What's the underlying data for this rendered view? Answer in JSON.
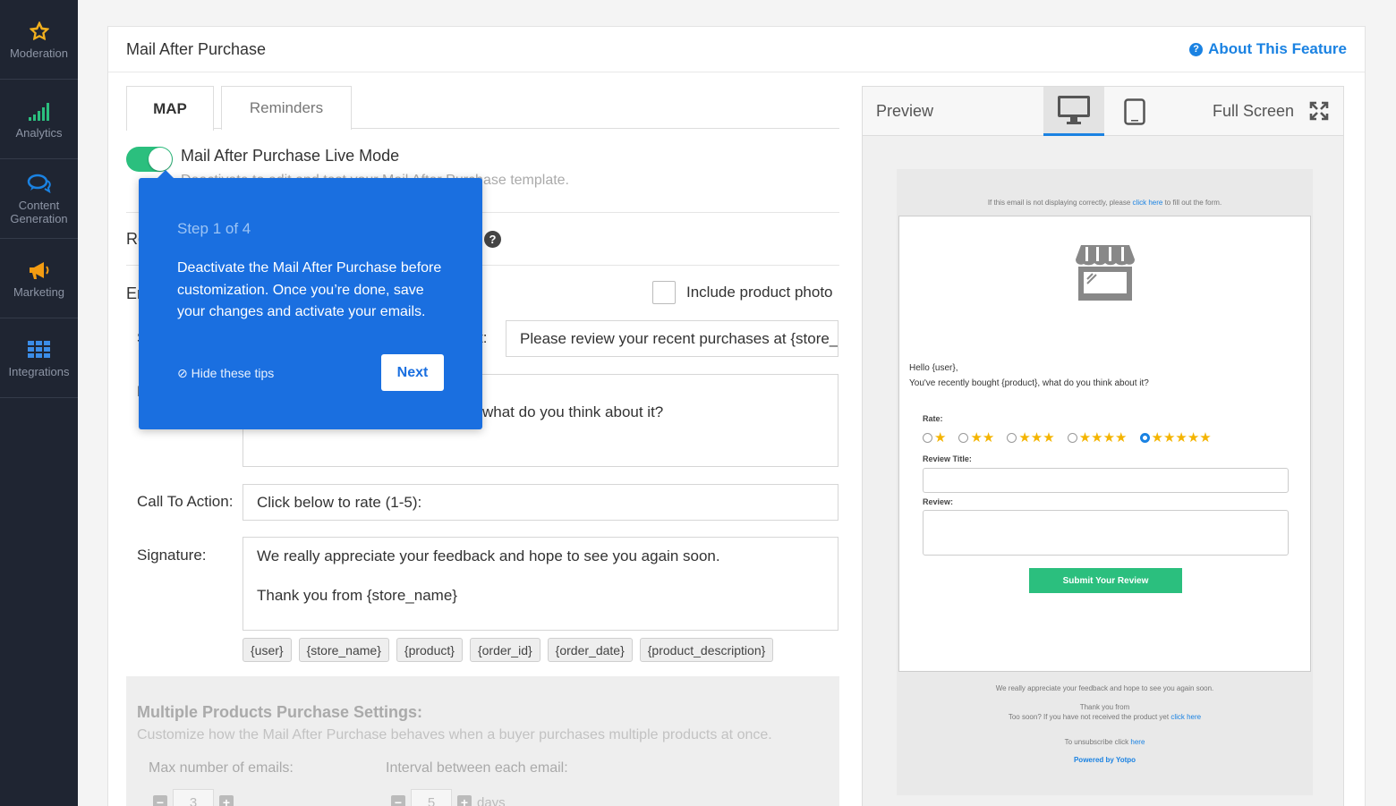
{
  "sidebar": {
    "items": [
      {
        "label": "Moderation",
        "icon": "star-icon"
      },
      {
        "label": "Analytics",
        "icon": "signal-bars-icon"
      },
      {
        "label": "Content Generation",
        "icon": "chat-bubbles-icon"
      },
      {
        "label": "Marketing",
        "icon": "megaphone-icon"
      },
      {
        "label": "Integrations",
        "icon": "grid-icon"
      }
    ]
  },
  "header": {
    "title": "Mail After Purchase",
    "about_link": "About This Feature"
  },
  "tabs": [
    {
      "label": "MAP",
      "active": true
    },
    {
      "label": "Reminders",
      "active": false
    }
  ],
  "live_mode": {
    "title": "Mail After Purchase Live Mode",
    "description": "Deactivate to edit and test your Mail After Purchase template.",
    "enabled": true
  },
  "sections": {
    "row2_label": "Re",
    "row3_label": "Er",
    "subject_label_partial": "S",
    "subject_colon": "t:",
    "body_label_partial": "B",
    "include_photo_label": "Include product photo",
    "include_photo_checked": false
  },
  "fields": {
    "subject_value": "Please review your recent purchases at {store_",
    "body_value": "what do you think about it?",
    "cta_label": "Call To Action:",
    "cta_value": "Click below to rate (1-5):",
    "signature_label": "Signature:",
    "signature_line1": "We really appreciate your feedback and hope to see you again soon.",
    "signature_line2": "Thank you from {store_name}"
  },
  "variable_tags": [
    "{user}",
    "{store_name}",
    "{product}",
    "{order_id}",
    "{order_date}",
    "{product_description}"
  ],
  "multi_products": {
    "title": "Multiple Products Purchase Settings:",
    "description": "Customize how the Mail After Purchase behaves when a buyer purchases multiple products at once.",
    "max_label": "Max number of emails:",
    "max_value": "3",
    "interval_label": "Interval between each email:",
    "interval_value": "5",
    "interval_unit": "days"
  },
  "preview": {
    "label": "Preview",
    "fullscreen_label": "Full Screen",
    "devices": [
      "desktop-icon",
      "tablet-icon"
    ],
    "active_device": "desktop-icon",
    "email": {
      "top_text": "If this email is not displaying correctly, please",
      "top_link": "click here",
      "top_text_end": "to fill out the form.",
      "greeting": "Hello {user},",
      "question": "You've recently bought {product}, what do you think about it?",
      "rate_label": "Rate:",
      "rating_options": [
        "★",
        "★★",
        "★★★",
        "★★★★",
        "★★★★★"
      ],
      "selected_rating": 5,
      "review_title_label": "Review Title:",
      "review_label": "Review:",
      "submit_label": "Submit Your Review",
      "footer_line1": "We really appreciate your feedback and hope to see you again soon.",
      "footer_line2": "Thank you from",
      "footer_line3": "Too soon? If you have not received the product yet",
      "footer_line3_link": "click here",
      "unsubscribe_text": "To unsubscribe click",
      "unsubscribe_link": "here",
      "powered_by": "Powered by Yotpo"
    }
  },
  "tooltip": {
    "step": "Step 1 of 4",
    "body": "Deactivate the Mail After Purchase before customization. Once you’re done, save your changes and activate your emails.",
    "hide_label": "⊘ Hide these tips",
    "next_label": "Next"
  },
  "colors": {
    "sidebar_bg": "#1f2532",
    "accent_blue": "#1a82e2",
    "tooltip_blue": "#1a6fe0",
    "toggle_green": "#2bbf7e",
    "star_gold": "#f4b400"
  }
}
